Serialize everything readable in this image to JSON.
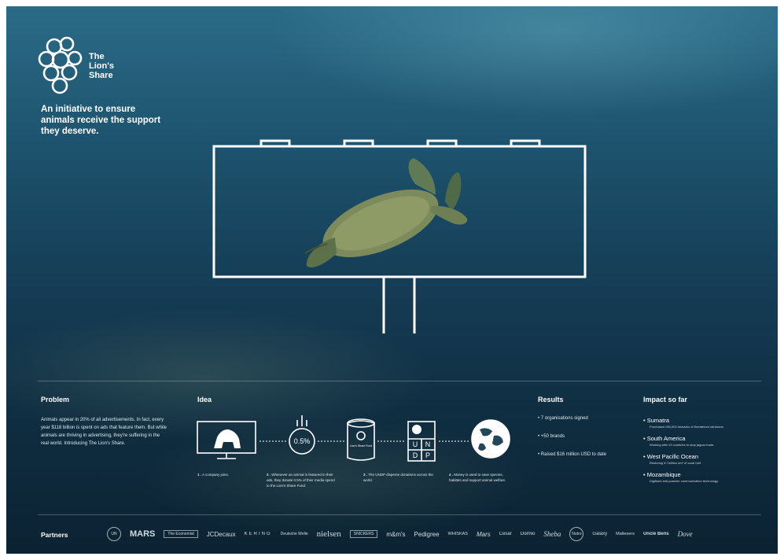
{
  "brand": {
    "name": "The\nLion's\nShare"
  },
  "tagline": "An initiative to ensure animals receive the support they deserve.",
  "problem": {
    "title": "Problem",
    "text": "Animals appear in 20% of all advertisements. In fact, every year $118 billion is spent on ads that feature them. But while animals are thriving in advertising, they're suffering in the real world. Introducing The Lion's Share."
  },
  "idea": {
    "title": "Idea",
    "percent": "0.5%",
    "steps": [
      {
        "num": "1 .",
        "text": "A company joins."
      },
      {
        "num": "2 .",
        "text": "Whenever an animal is featured in their ads, they donate 0.5% of their media spend to the Lion's Share Fund."
      },
      {
        "num": "3 .",
        "text": "The UNDP disperse donations across the world."
      },
      {
        "num": "4 .",
        "text": "Money is used to save species, habitats and support animal welfare."
      }
    ],
    "fund_label": "Lion's Share Fund",
    "undp_letters": [
      "U",
      "N",
      "D",
      "P"
    ]
  },
  "results": {
    "title": "Results",
    "items": [
      "• 7 organisations signed",
      "• +50 brands",
      "• Raised $16 million USD to date"
    ]
  },
  "impact": {
    "title": "Impact so far",
    "items": [
      {
        "name": "• Sumatra",
        "desc": "Purchased 260,000 hectares of threatened rainforest."
      },
      {
        "name": "• South America",
        "desc": "Working with 13 countries to stop jaguar trade."
      },
      {
        "name": "• West Pacific Ocean",
        "desc": "Restoring 5.7million km² of coral reef."
      },
      {
        "name": "• Mozambique",
        "desc": "Digitised anti-poacher communication technology."
      }
    ]
  },
  "partners": {
    "label": "Partners",
    "logos": [
      "UN",
      "MARS",
      "The Economist",
      "JCDecaux",
      "KERING",
      "Deutsche Welle",
      "nielsen",
      "SNICKERS",
      "m&m's",
      "Pedigree",
      "WHISKAS",
      "Mars",
      "Cesar",
      "Dolmio",
      "Sheba",
      "Nutro",
      "Galaxy",
      "Maltesers",
      "Uncle Bens",
      "Dove"
    ]
  }
}
